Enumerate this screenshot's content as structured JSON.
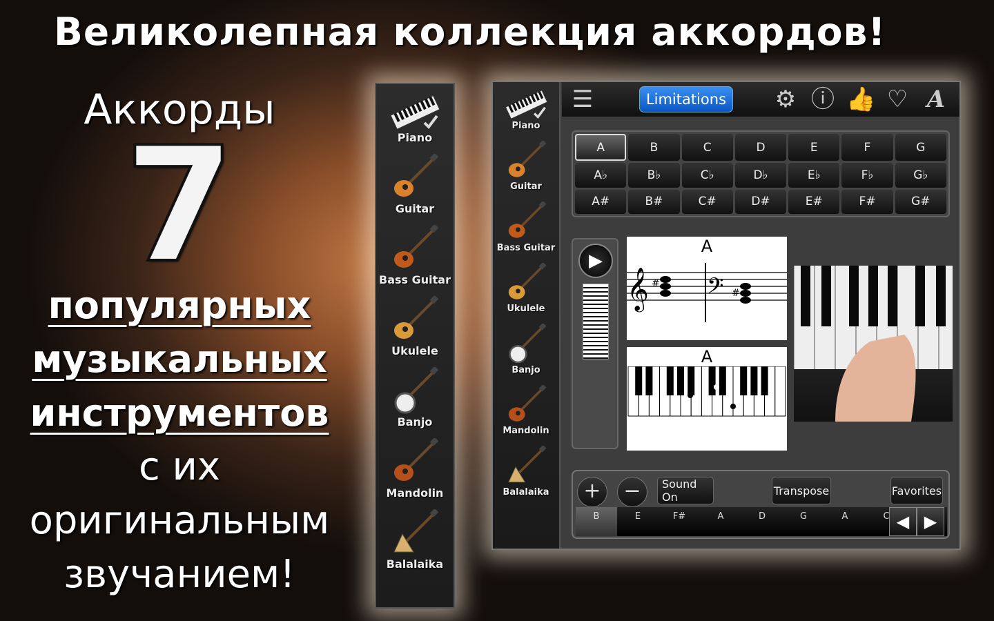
{
  "headline": "Великолепная коллекция аккордов!",
  "promo": {
    "line1": "Аккорды",
    "number": "7",
    "underlined": [
      "популярных",
      "музыкальных",
      "инструментов"
    ],
    "plain": [
      "с их",
      "оригинальным",
      "звучанием!"
    ]
  },
  "instruments": [
    {
      "label": "Piano",
      "icon": "piano-icon"
    },
    {
      "label": "Guitar",
      "icon": "guitar-icon"
    },
    {
      "label": "Bass Guitar",
      "icon": "bass-guitar-icon"
    },
    {
      "label": "Ukulele",
      "icon": "ukulele-icon"
    },
    {
      "label": "Banjo",
      "icon": "banjo-icon"
    },
    {
      "label": "Mandolin",
      "icon": "mandolin-icon"
    },
    {
      "label": "Balalaika",
      "icon": "balalaika-icon"
    }
  ],
  "toolbar": {
    "limitations": "Limitations",
    "icons": [
      "gear-icon",
      "info-icon",
      "thumbs-up-icon",
      "heart-icon",
      "font-icon"
    ]
  },
  "notes": [
    [
      "A",
      "B",
      "C",
      "D",
      "E",
      "F",
      "G"
    ],
    [
      "A♭",
      "B♭",
      "C♭",
      "D♭",
      "E♭",
      "F♭",
      "G♭"
    ],
    [
      "A#",
      "B#",
      "C#",
      "D#",
      "E#",
      "F#",
      "G#"
    ]
  ],
  "selected_note": "A",
  "chord_label": "A",
  "bottom": {
    "sound": "Sound On",
    "transpose": "Transpose",
    "favorites": "Favorites",
    "strip": [
      "B",
      "E",
      "F#",
      "A",
      "D",
      "G",
      "A",
      "C"
    ]
  },
  "colors": {
    "accent": "#1a6fe0"
  }
}
